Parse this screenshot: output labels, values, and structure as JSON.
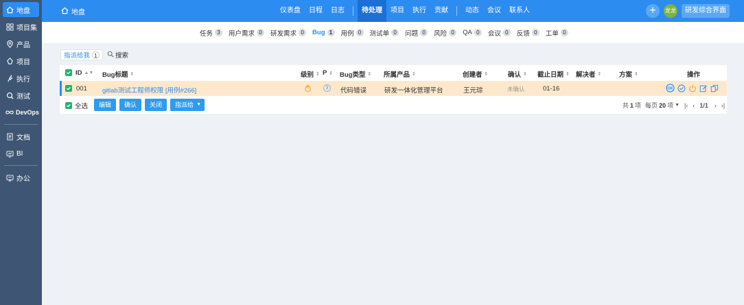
{
  "sidebar": {
    "items": [
      {
        "label": "地盘",
        "icon": "home-icon"
      },
      {
        "label": "项目集",
        "icon": "grid-icon"
      },
      {
        "label": "产品",
        "icon": "location-icon"
      },
      {
        "label": "项目",
        "icon": "project-icon"
      },
      {
        "label": "执行",
        "icon": "run-icon"
      },
      {
        "label": "测试",
        "icon": "test-icon"
      },
      {
        "label": "DevOps",
        "icon": "infinity-icon"
      },
      {
        "label": "文档",
        "icon": "doc-icon"
      },
      {
        "label": "BI",
        "icon": "bi-icon"
      },
      {
        "label": "办公",
        "icon": "office-icon"
      }
    ]
  },
  "topbar": {
    "home_label": "地盘",
    "nav": [
      "仪表盘",
      "日程",
      "日志",
      "待处理",
      "项目",
      "执行",
      "贡献",
      "动态",
      "会议",
      "联系人"
    ],
    "avatar_text": "龙龙",
    "plus": "+",
    "switch_label": "研发综合界面"
  },
  "subtabs": [
    {
      "label": "任务",
      "count": "3"
    },
    {
      "label": "用户需求",
      "count": "0"
    },
    {
      "label": "研发需求",
      "count": "0"
    },
    {
      "label": "Bug",
      "count": "1"
    },
    {
      "label": "用例",
      "count": "0"
    },
    {
      "label": "测试单",
      "count": "0"
    },
    {
      "label": "问题",
      "count": "0"
    },
    {
      "label": "风险",
      "count": "0"
    },
    {
      "label": "QA",
      "count": "0"
    },
    {
      "label": "会议",
      "count": "0"
    },
    {
      "label": "反馈",
      "count": "0"
    },
    {
      "label": "工单",
      "count": "0"
    }
  ],
  "filter": {
    "assigned_label": "指派给我",
    "assigned_count": "1",
    "search_label": "搜索"
  },
  "table": {
    "headers": {
      "id": "ID",
      "title": "Bug标题",
      "severity": "级别",
      "pri": "P",
      "type": "Bug类型",
      "product": "所属产品",
      "creator": "创建者",
      "confirmed": "确认",
      "deadline": "截止日期",
      "resolver": "解决者",
      "resolution": "方案",
      "actions": "操作"
    },
    "rows": [
      {
        "id": "001",
        "title": "gitlab测试工程师权限 [用例#266]",
        "severity": "3",
        "pri": "3",
        "type": "代码错误",
        "product": "研发一体化管理平台",
        "creator": "王元琮",
        "confirmed": "未确认",
        "deadline": "01-16",
        "resolver": "",
        "resolution": ""
      }
    ]
  },
  "footer": {
    "select_all": "全选",
    "buttons": [
      "编辑",
      "确认",
      "关闭",
      "指派给"
    ],
    "total_prefix": "共",
    "total": "1",
    "total_suffix": "项",
    "per_page_prefix": "每页",
    "per_page": "20",
    "per_page_suffix": "项",
    "page": "1/1"
  },
  "colors": {
    "primary": "#2d8cf0",
    "sidebar": "#3e5673",
    "row_highlight": "#fde8cc",
    "checkbox": "#24b26b"
  }
}
